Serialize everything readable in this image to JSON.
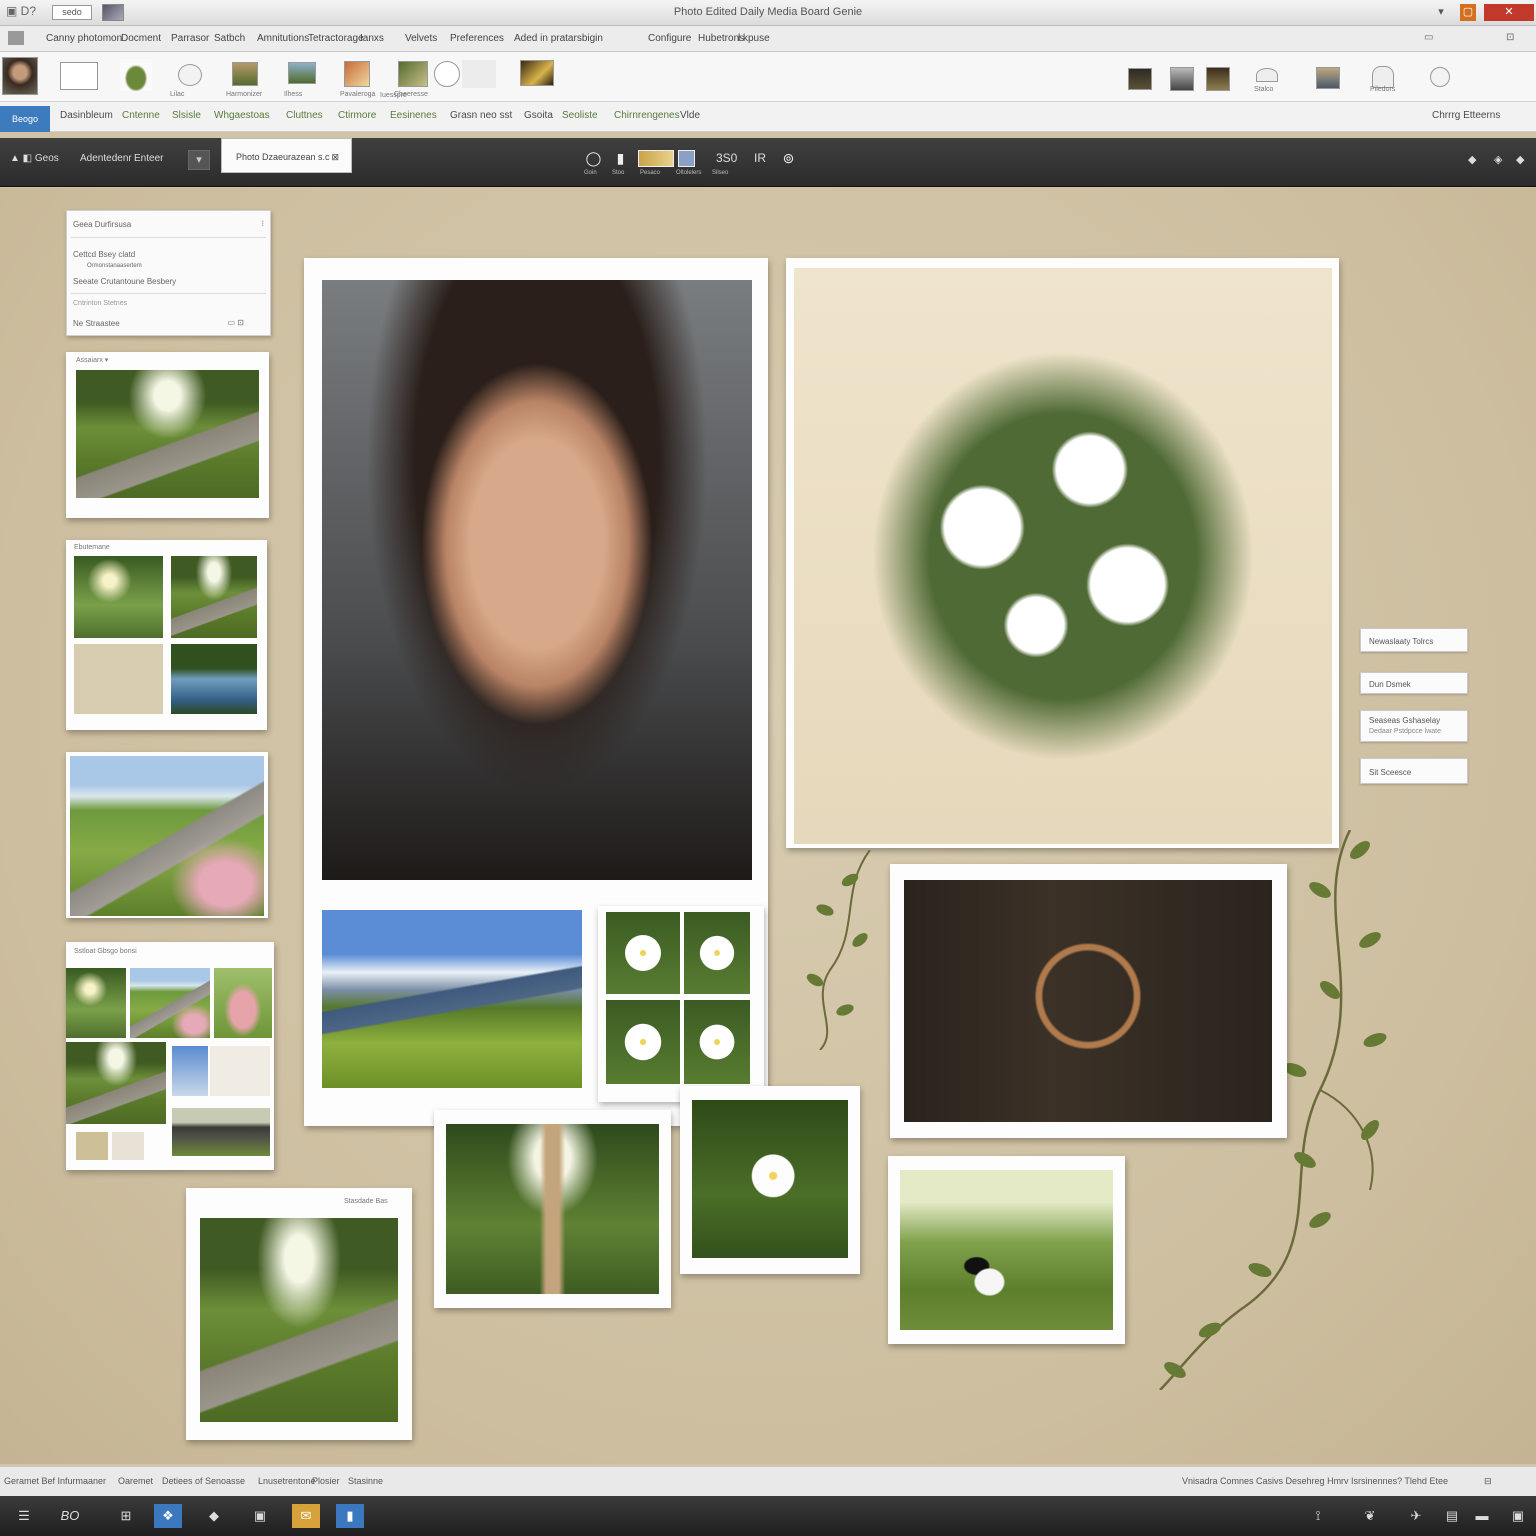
{
  "titlebar": {
    "logo": "▣ D?",
    "box_label": "sedo",
    "title": "Photo Edited Daily Media Board Genie",
    "minimize": "▾",
    "maximize": "▢",
    "close": "✕"
  },
  "menubar": {
    "items": [
      "Canny photomon",
      "Docment",
      "Parrasor",
      "Satbch",
      "Amnitutions",
      "Tetractorage",
      "Ianxs",
      "Velvets",
      "Preferences",
      "Aded in pratarsbigin",
      "Configure",
      "Hubetrons",
      "l kpuse"
    ],
    "right1": "▭",
    "right2": "⊡"
  },
  "ribbon": {
    "labels": [
      "Lilac",
      "Harmonizer",
      "Ilhess",
      "Pavaleroga",
      "Cheeresse",
      "Iuesspre"
    ],
    "right_labels": [
      "Stalco",
      "Piledors"
    ]
  },
  "tabs": {
    "active": "Beogo",
    "items": [
      "Dasinbleum",
      "Cntenne",
      "Slsisle",
      "Whgaestoas",
      "Cluttnes",
      "Ctirmore",
      "Eesinenes",
      "Grasn neo sst",
      "Gsoita",
      "Seoliste",
      "Chirnrengenes",
      "Vlde"
    ],
    "right": "Chrrrg Etteerns"
  },
  "darkbar": {
    "left_text1": "▲ ◧ Geos",
    "left_text2": "Adentedenr",
    "left_text3": "Enteer",
    "btn": "▾",
    "doc_tab": "Photo Dzaeurazean s.c",
    "doc_tab_close": "⊠",
    "counter1": "3S0",
    "counter2": "IR",
    "tool_labels": [
      "Goin",
      "Stoo",
      "Pesaco",
      "Oltolelers",
      "Silseo"
    ],
    "right_icons": [
      "◆",
      "◈",
      "◆"
    ]
  },
  "left_panel": {
    "title": "Geea Durfirsusa",
    "line1": "Cettcd Bsey clatd",
    "line2": "Ormonstanaasertem",
    "line3": "Seeate Crutantoune Besbery",
    "line4": "Cntrinton Stetnes",
    "line5": "Ne Straastee",
    "footer_icons": "▭ ⊡"
  },
  "captions": {
    "card_a": "Assaiarx ▾",
    "card_b": "Ebutemane",
    "card_d": "Sstloat Gbsgo bonsi",
    "card_bottom": "Stasdade Bas"
  },
  "right_buttons": [
    {
      "line1": "Newaslaaty Tolrcs"
    },
    {
      "line1": "Dun Dsmek"
    },
    {
      "line1": "Seaseas Gshaselay",
      "line2": "Dedaar Pstdpcce lwate"
    },
    {
      "line1": "Sit Sceesce"
    }
  ],
  "statusbar": {
    "left1": "Geramet Bef Infurmaaner",
    "left2": "Oaremet",
    "left3": "Detiees of Senoasse",
    "left4": "Lnusetrentone",
    "left5": "Plosier",
    "left6": "Stasinne",
    "right": "Vnisadra Comnes Casivs Desehreg Hmrv Isrsinennes? Tlehd Etee",
    "right_icon": "⊟"
  },
  "taskbar": {
    "items": [
      "☰",
      "BO",
      "⊞",
      "❖",
      "◆",
      "▣",
      "✉",
      "▮",
      "⟟",
      "❦",
      "✈",
      "▤",
      "▬",
      "▣"
    ]
  },
  "colors": {
    "accent": "#3d7bbf",
    "canvas": "#cdbe9f",
    "dark_toolbar": "#2c2c2c",
    "leaf": "#667a35"
  }
}
